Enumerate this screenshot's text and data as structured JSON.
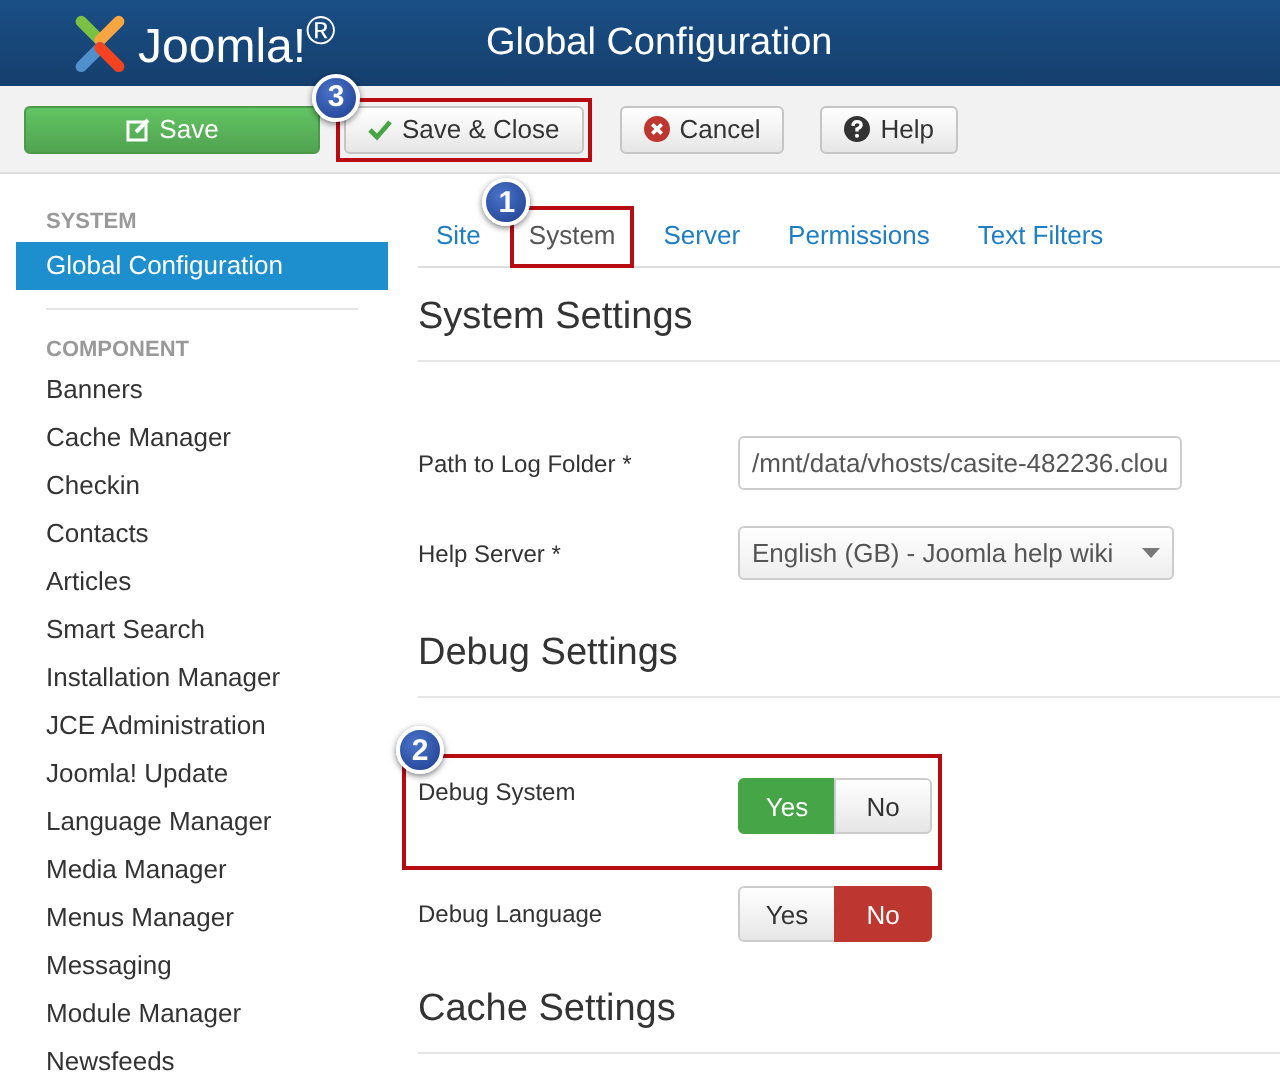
{
  "header": {
    "logo": "Joomla!$^{®}$",
    "title": "Global Configuration"
  },
  "toolbar": [
    {
      "label": "Save",
      "kind": "primary",
      "highlighted": false
    },
    {
      "label": "Save & Close",
      "kind": "check",
      "highlighted": true,
      "callout": "3"
    },
    {
      "label": "Cancel",
      "kind": "cancel",
      "highlighted": false
    },
    {
      "label": "Help",
      "kind": "help",
      "highlighted": false
    }
  ],
  "sidebar": {
    "sections": [
      {
        "heading": "SYSTEM",
        "items": [
          {
            "label": "Global Configuration",
            "selected": true
          }
        ]
      },
      {
        "heading": "COMPONENT",
        "items": [
          {
            "label": "Banners",
            "selected": false
          },
          {
            "label": "Cache Manager",
            "selected": false
          },
          {
            "label": "Checkin",
            "selected": false
          },
          {
            "label": "Contacts",
            "selected": false
          },
          {
            "label": "Articles",
            "selected": false
          },
          {
            "label": "Smart Search",
            "selected": false
          },
          {
            "label": "Installation Manager",
            "selected": false
          },
          {
            "label": "JCE Administration",
            "selected": false
          },
          {
            "label": "Joomla! Update",
            "selected": false
          },
          {
            "label": "Language Manager",
            "selected": false
          },
          {
            "label": "Media Manager",
            "selected": false
          },
          {
            "label": "Menus Manager",
            "selected": false
          },
          {
            "label": "Messaging",
            "selected": false
          },
          {
            "label": "Module Manager",
            "selected": false
          },
          {
            "label": "Newsfeeds",
            "selected": false
          }
        ]
      }
    ]
  },
  "tabs": [
    {
      "label": "Site",
      "selected": false,
      "highlighted": false
    },
    {
      "label": "System",
      "selected": true,
      "highlighted": true,
      "callout": "1"
    },
    {
      "label": "Server",
      "selected": false,
      "highlighted": false
    },
    {
      "label": "Permissions",
      "selected": false,
      "highlighted": false
    },
    {
      "label": "Text Filters",
      "selected": false,
      "highlighted": false
    }
  ],
  "sections": [
    {
      "title": "System Settings",
      "rows": [
        {
          "kind": "text",
          "label": "Path to Log Folder *",
          "value": "/mnt/data/vhosts/casite-482236.clou"
        },
        {
          "kind": "select",
          "label": "Help Server *",
          "value": "English (GB) - Joomla help wiki"
        }
      ]
    },
    {
      "title": "Debug Settings",
      "rows": [
        {
          "kind": "toggle",
          "label": "Debug System",
          "highlighted": true,
          "callout": "2",
          "options": [
            {
              "label": "Yes",
              "selected": true
            },
            {
              "label": "No",
              "selected": false
            }
          ]
        },
        {
          "kind": "toggle",
          "label": "Debug Language",
          "highlighted": false,
          "options": [
            {
              "label": "Yes",
              "selected": false
            },
            {
              "label": "No",
              "selected": true
            }
          ]
        }
      ]
    },
    {
      "title": "Cache Settings"
    }
  ]
}
